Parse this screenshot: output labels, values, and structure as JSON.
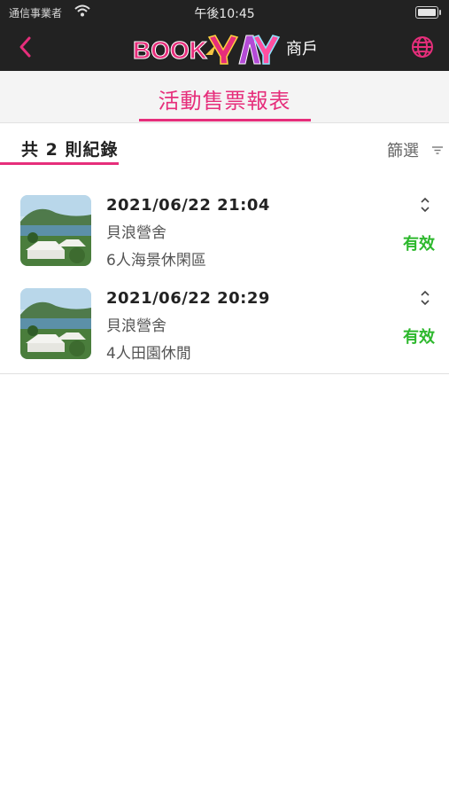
{
  "status_bar": {
    "carrier": "通信事業者",
    "time": "午後10:45"
  },
  "nav": {
    "logo_text": "BOOK YAY",
    "merchant_label": "商戶"
  },
  "page": {
    "title": "活動售票報表"
  },
  "summary": {
    "record_count": "共 2 則紀錄",
    "filter_label": "篩選"
  },
  "records": [
    {
      "datetime": "2021/06/22 21:04",
      "venue": "貝浪營舍",
      "product": "6人海景休閑區",
      "status": "有效"
    },
    {
      "datetime": "2021/06/22 20:29",
      "venue": "貝浪營舍",
      "product": "4人田園休閒",
      "status": "有效"
    }
  ],
  "colors": {
    "accent": "#e62e7b",
    "nav_bg": "#222222",
    "status_valid": "#2db82d"
  },
  "icons": {
    "back": "chevron-left-icon",
    "globe": "globe-icon",
    "filter": "filter-icon",
    "expand": "chevron-up-down-icon",
    "wifi": "wifi-icon",
    "battery": "battery-icon"
  }
}
